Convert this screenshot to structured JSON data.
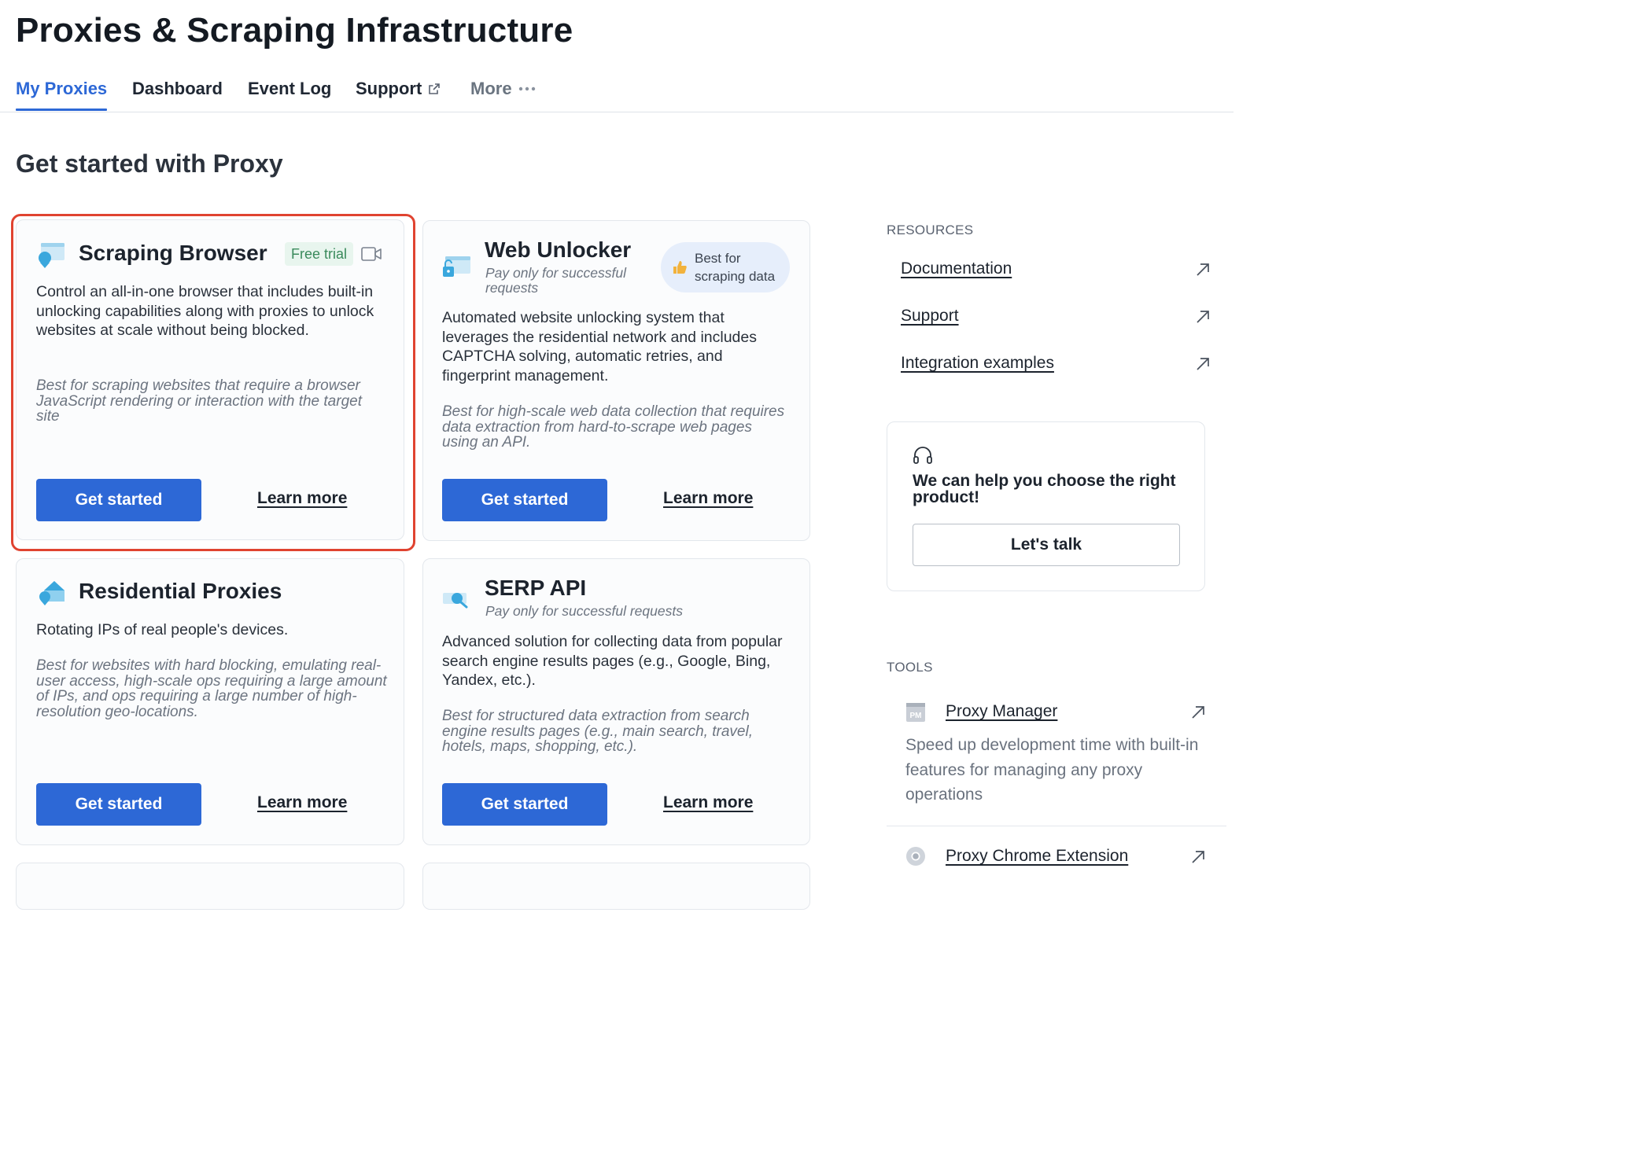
{
  "page": {
    "title": "Proxies & Scraping Infrastructure"
  },
  "tabs": [
    {
      "label": "My Proxies",
      "active": true
    },
    {
      "label": "Dashboard"
    },
    {
      "label": "Event Log"
    },
    {
      "label": "Support",
      "icon": "external-link-icon"
    },
    {
      "label": "More",
      "icon": "ellipsis-icon"
    }
  ],
  "section": {
    "title": "Get started with Proxy"
  },
  "cards": [
    {
      "title": "Scraping Browser",
      "badge": "Free trial",
      "icon": "scraping-browser-icon",
      "extra_icon": "video-camera-icon",
      "description": "Control an all-in-one browser that includes built-in unlocking capabilities along with proxies to unlock websites at scale without being blocked.",
      "best_for": "Best for scraping websites that require a browser JavaScript rendering or interaction with the target site",
      "primary": "Get started",
      "secondary": "Learn more",
      "highlighted": true
    },
    {
      "title": "Web Unlocker",
      "subtitle": "Pay only for successful requests",
      "badge": "Best for scraping data",
      "badge_icon": "thumbs-up-icon",
      "icon": "web-unlocker-icon",
      "description": "Automated website unlocking system that leverages the residential network and includes CAPTCHA solving, automatic retries, and fingerprint management.",
      "best_for": "Best for high-scale web data collection that requires data extraction from hard-to-scrape web pages using an API.",
      "primary": "Get started",
      "secondary": "Learn more"
    },
    {
      "title": "Residential Proxies",
      "icon": "residential-home-icon",
      "description": "Rotating IPs of real people's devices.",
      "best_for": "Best for websites with hard blocking, emulating real-user access, high-scale ops requiring a large amount of IPs, and ops requiring a large number of high-resolution geo-locations.",
      "primary": "Get started",
      "secondary": "Learn more"
    },
    {
      "title": "SERP API",
      "subtitle": "Pay only for successful requests",
      "icon": "serp-search-icon",
      "description": "Advanced solution for collecting data from popular search engine results pages (e.g., Google, Bing, Yandex, etc.).",
      "best_for": "Best for structured data extraction from search engine results pages (e.g., main search, travel, hotels, maps, shopping, etc.).",
      "primary": "Get started",
      "secondary": "Learn more"
    }
  ],
  "resources": {
    "heading": "RESOURCES",
    "links": [
      "Documentation",
      "Support",
      "Integration examples"
    ]
  },
  "help": {
    "icon": "headset-icon",
    "text": "We can help you choose the right product!",
    "button": "Let's talk"
  },
  "tools": {
    "heading": "TOOLS",
    "items": [
      {
        "label": "Proxy Manager",
        "icon": "proxy-manager-icon",
        "icon_text": "PM",
        "description": "Speed up development time with built-in features for managing any proxy operations"
      },
      {
        "label": "Proxy Chrome Extension",
        "icon": "chrome-icon"
      }
    ]
  },
  "colors": {
    "accent": "#2d68d6",
    "highlight": "#e04330",
    "badge_green": "#3a8a5c"
  }
}
